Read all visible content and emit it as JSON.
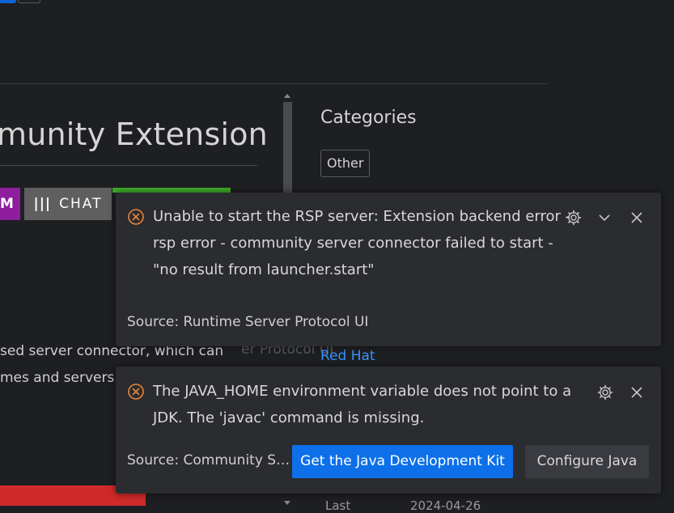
{
  "background": {
    "extension_title": "munity Extension",
    "badges": {
      "chat_icon": "|||",
      "chat_label": "CHAT",
      "purple_fragment": "M"
    },
    "categories": {
      "heading": "Categories",
      "items": [
        "Other"
      ]
    },
    "description_lines": [
      "sed server connector, which can",
      "mes and servers"
    ],
    "ghost_text": "er Protocol UI",
    "publisher_link": "Red Hat",
    "bottom_row": {
      "label": "Last",
      "value": "2024-04-26"
    }
  },
  "notifications": [
    {
      "icon": "error-circle-icon",
      "message": "Unable to start the RSP server: Extension backend error - rsp error - community server connector failed to start - \"no result from launcher.start\"",
      "source": "Source: Runtime Server Protocol UI",
      "tools": [
        "gear-icon",
        "chevron-down-icon",
        "close-icon"
      ]
    },
    {
      "icon": "error-circle-icon",
      "message": "The JAVA_HOME environment variable does not point to a JDK. The 'javac' command is missing.",
      "source": "Source: Community S…",
      "primary_button": "Get the Java Development Kit",
      "secondary_button": "Configure Java",
      "tools": [
        "gear-icon",
        "close-icon"
      ]
    }
  ],
  "colors": {
    "error": "#e8853a",
    "primary_button": "#0e70e8",
    "link": "#3794ff",
    "badge_green": "#3fae2a",
    "badge_purple": "#8e1e9d",
    "red_bar": "#d12a2a"
  }
}
